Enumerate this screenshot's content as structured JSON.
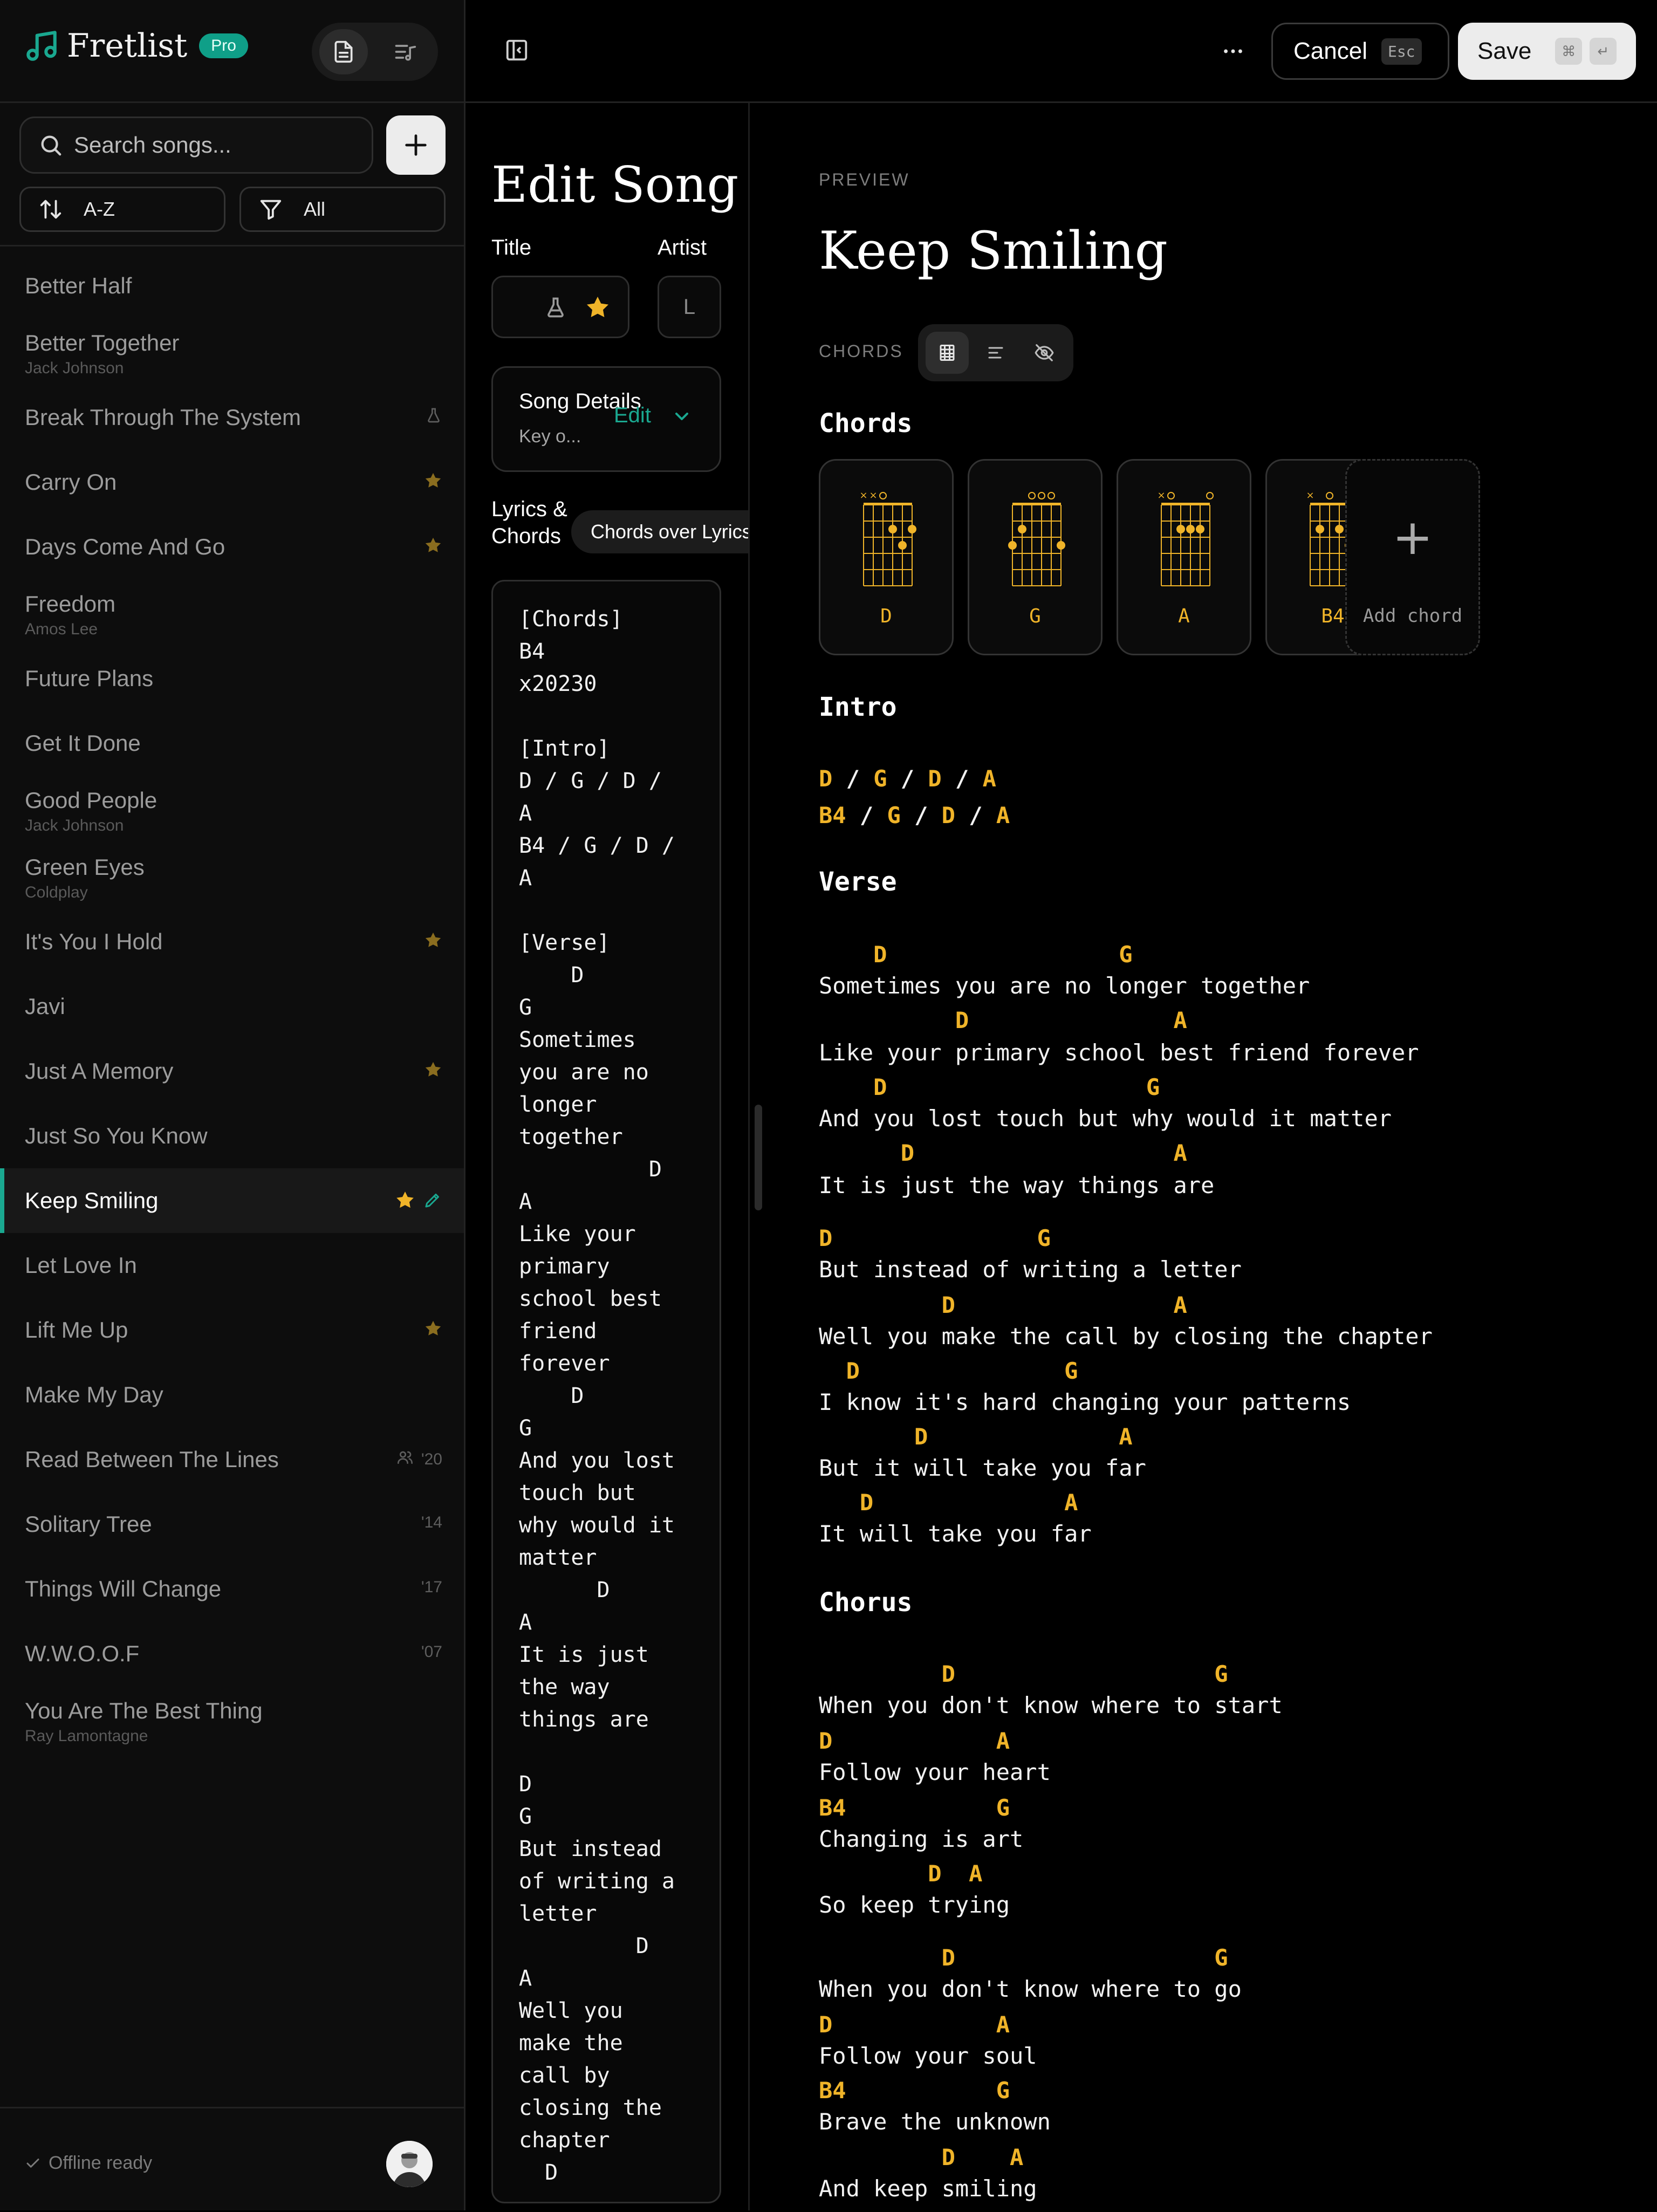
{
  "app": {
    "name": "Fretlist",
    "badge": "Pro"
  },
  "search": {
    "placeholder": "Search songs..."
  },
  "filters": {
    "sort_label": "A-Z",
    "filter_label": "All"
  },
  "songs": [
    {
      "name": "Better Half",
      "artist": "",
      "meta": ""
    },
    {
      "name": "Better Together",
      "artist": "Jack Johnson",
      "meta": ""
    },
    {
      "name": "Break Through The System",
      "artist": "",
      "meta": "",
      "icon": "flask-icon"
    },
    {
      "name": "Carry On",
      "artist": "",
      "meta": "",
      "icon": "star-icon"
    },
    {
      "name": "Days Come And Go",
      "artist": "",
      "meta": "",
      "icon": "star-icon"
    },
    {
      "name": "Freedom",
      "artist": "Amos Lee",
      "meta": ""
    },
    {
      "name": "Future Plans",
      "artist": "",
      "meta": ""
    },
    {
      "name": "Get It Done",
      "artist": "",
      "meta": ""
    },
    {
      "name": "Good People",
      "artist": "Jack Johnson",
      "meta": ""
    },
    {
      "name": "Green Eyes",
      "artist": "Coldplay",
      "meta": ""
    },
    {
      "name": "It's You I Hold",
      "artist": "",
      "meta": "",
      "icon": "star-icon"
    },
    {
      "name": "Javi",
      "artist": "",
      "meta": ""
    },
    {
      "name": "Just A Memory",
      "artist": "",
      "meta": "",
      "icon": "star-icon"
    },
    {
      "name": "Just So You Know",
      "artist": "",
      "meta": ""
    },
    {
      "name": "Keep Smiling",
      "artist": "",
      "meta": "",
      "selected": true
    },
    {
      "name": "Let Love In",
      "artist": "",
      "meta": ""
    },
    {
      "name": "Lift Me Up",
      "artist": "",
      "meta": "",
      "icon": "star-icon"
    },
    {
      "name": "Make My Day",
      "artist": "",
      "meta": ""
    },
    {
      "name": "Read Between The Lines",
      "artist": "",
      "meta": "'20",
      "icon": "users-icon"
    },
    {
      "name": "Solitary Tree",
      "artist": "",
      "meta": "'14"
    },
    {
      "name": "Things Will Change",
      "artist": "",
      "meta": "'17"
    },
    {
      "name": "W.W.O.O.F",
      "artist": "",
      "meta": "'07"
    },
    {
      "name": "You Are The Best Thing",
      "artist": "Ray Lamontagne",
      "meta": ""
    }
  ],
  "footer": {
    "status": "Offline ready"
  },
  "topbar": {
    "cancel_label": "Cancel",
    "cancel_key": "Esc",
    "save_label": "Save",
    "save_key1": "⌘",
    "save_key2": "↵"
  },
  "editor": {
    "heading": "Edit Song",
    "title_label": "Title",
    "artist_label": "Artist",
    "artist_value": "L",
    "details_title": "Song Details",
    "details_sub": "Key o...",
    "details_edit": "Edit",
    "lyrics_label": "Lyrics & Chords",
    "mode_label": "Chords over Lyrics",
    "text": "[Chords]\nB4\nx20230\n\n[Intro]\nD / G / D /\nA\nB4 / G / D /\nA\n\n[Verse]\n    D\nG\nSometimes\nyou are no\nlonger\ntogether\n          D\nA\nLike your\nprimary\nschool best\nfriend\nforever\n    D\nG\nAnd you lost\ntouch but\nwhy would it\nmatter\n      D\nA\nIt is just\nthe way\nthings are\n\nD\nG\nBut instead\nof writing a\nletter\n         D\nA\nWell you\nmake the\ncall by\nclosing the\nchapter\n  D"
  },
  "preview": {
    "label": "PREVIEW",
    "title": "Keep Smiling",
    "chords_label": "CHORDS",
    "chords_heading": "Chords",
    "chords": [
      {
        "name": "D",
        "top": [
          "x",
          "x",
          "o",
          "",
          "",
          ""
        ],
        "dots": [
          [
            3,
            2
          ],
          [
            4,
            3
          ],
          [
            5,
            2
          ]
        ]
      },
      {
        "name": "G",
        "top": [
          "",
          "",
          "o",
          "o",
          "o",
          ""
        ],
        "dots": [
          [
            0,
            3
          ],
          [
            1,
            2
          ],
          [
            5,
            3
          ]
        ]
      },
      {
        "name": "A",
        "top": [
          "x",
          "o",
          "",
          "",
          "",
          "o"
        ],
        "dots": [
          [
            2,
            2
          ],
          [
            3,
            2
          ],
          [
            4,
            2
          ]
        ]
      },
      {
        "name": "B4",
        "top": [
          "x",
          "",
          "o",
          "",
          "",
          "o"
        ],
        "dots": [
          [
            1,
            2
          ],
          [
            3,
            2
          ],
          [
            4,
            3
          ]
        ]
      }
    ],
    "add_chord": "Add chord",
    "sections": [
      {
        "title": "Intro",
        "lines": [
          {
            "kind": "prog",
            "text": "D / G / D / A"
          },
          {
            "kind": "prog",
            "text": "B4 / G / D / A"
          }
        ]
      },
      {
        "title": "Verse",
        "lines": [
          {
            "kind": "chord",
            "text": "    D                 G"
          },
          {
            "kind": "lyric",
            "text": "Sometimes you are no longer together"
          },
          {
            "kind": "chord",
            "text": "          D               A"
          },
          {
            "kind": "lyric",
            "text": "Like your primary school best friend forever"
          },
          {
            "kind": "chord",
            "text": "    D                   G"
          },
          {
            "kind": "lyric",
            "text": "And you lost touch but why would it matter"
          },
          {
            "kind": "chord",
            "text": "      D                   A"
          },
          {
            "kind": "lyric",
            "text": "It is just the way things are"
          },
          {
            "kind": "chord",
            "text": "D               G"
          },
          {
            "kind": "lyric",
            "text": "But instead of writing a letter"
          },
          {
            "kind": "chord",
            "text": "         D                A"
          },
          {
            "kind": "lyric",
            "text": "Well you make the call by closing the chapter"
          },
          {
            "kind": "chord",
            "text": "  D               G"
          },
          {
            "kind": "lyric",
            "text": "I know it's hard changing your patterns"
          },
          {
            "kind": "chord",
            "text": "       D              A"
          },
          {
            "kind": "lyric",
            "text": "But it will take you far"
          },
          {
            "kind": "chord",
            "text": "   D              A"
          },
          {
            "kind": "lyric",
            "text": "It will take you far"
          }
        ]
      },
      {
        "title": "Chorus",
        "lines": [
          {
            "kind": "chord",
            "text": "         D                   G"
          },
          {
            "kind": "lyric",
            "text": "When you don't know where to start"
          },
          {
            "kind": "chord",
            "text": "D            A"
          },
          {
            "kind": "lyric",
            "text": "Follow your heart"
          },
          {
            "kind": "chord",
            "text": "B4           G"
          },
          {
            "kind": "lyric",
            "text": "Changing is art"
          },
          {
            "kind": "chord",
            "text": "        D  A"
          },
          {
            "kind": "lyric",
            "text": "So keep trying"
          },
          {
            "kind": "chord",
            "text": "         D                   G"
          },
          {
            "kind": "lyric",
            "text": "When you don't know where to go"
          },
          {
            "kind": "chord",
            "text": "D            A"
          },
          {
            "kind": "lyric",
            "text": "Follow your soul"
          },
          {
            "kind": "chord",
            "text": "B4           G"
          },
          {
            "kind": "lyric",
            "text": "Brave the unknown"
          },
          {
            "kind": "chord",
            "text": "         D    A"
          },
          {
            "kind": "lyric",
            "text": "And keep smiling"
          }
        ]
      }
    ]
  },
  "colors": {
    "accent": "#1aa890",
    "chord": "#f0b429",
    "star": "#8a6d1f"
  }
}
